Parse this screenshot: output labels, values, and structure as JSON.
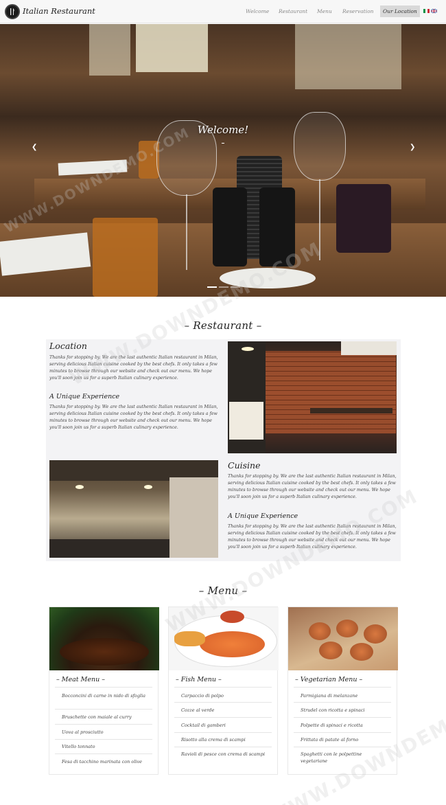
{
  "nav": {
    "brand": "Italian Restaurant",
    "links": [
      "Welcome",
      "Restaurant",
      "Menu",
      "Reservation",
      "Our Location"
    ],
    "active": "Our Location"
  },
  "hero": {
    "title": "Welcome!",
    "prev_icon": "chevron-left-icon",
    "next_icon": "chevron-right-icon",
    "slides": 3,
    "active_slide": 1
  },
  "restaurant": {
    "title": "– Restaurant –",
    "location": {
      "heading": "Location",
      "text": "Thanks for stopping by. We are the last authentic Italian restaurant in Milan, serving delicious Italian cuisine cooked by the best chefs. It only takes a few minutes to browse through our website and check out our menu. We hope you'll soon join us for a superb Italian culinary experience."
    },
    "unique1": {
      "heading": "A Unique Experience",
      "text": "Thanks for stopping by. We are the last authentic Italian restaurant in Milan, serving delicious Italian cuisine cooked by the best chefs. It only takes a few minutes to browse through our website and check out our menu. We hope you'll soon join us for a superb Italian culinary experience."
    },
    "cuisine": {
      "heading": "Cuisine",
      "text": "Thanks for stopping by. We are the last authentic Italian restaurant in Milan, serving delicious Italian cuisine cooked by the best chefs. It only takes a few minutes to browse through our website and check out our menu. We hope you'll soon join us for a superb Italian culinary experience."
    },
    "unique2": {
      "heading": "A Unique Experience",
      "text": "Thanks for stopping by. We are the last authentic Italian restaurant in Milan, serving delicious Italian cuisine cooked by the best chefs. It only takes a few minutes to browse through our website and check out our menu. We hope you'll soon join us for a superb Italian culinary experience."
    }
  },
  "menu": {
    "title": "– Menu –",
    "cards": [
      {
        "title": "– Meat Menu –",
        "items": [
          "Bocconcini di carne in nido di sfoglia",
          "Bruschette con maiale al curry",
          "Uova al prosciutto",
          "Vitello tonnato",
          "Fesa di tacchino marinata con olive"
        ]
      },
      {
        "title": "– Fish Menu –",
        "items": [
          "Carpaccio di polpo",
          "Cozze al verde",
          "Cocktail di gamberi",
          "Risotto alla crema di scampi",
          "Ravioli di pesce con crema di scampi"
        ]
      },
      {
        "title": "– Vegetarian Menu –",
        "items": [
          "Parmigiana di melanzane",
          "Strudel con ricotta e spinaci",
          "Polpette di spinaci e ricotta",
          "Frittata di patate al forno",
          "Spaghetti con le polpettine vegetariane"
        ]
      }
    ]
  },
  "watermark": "WWW.DOWNDEMO.COM",
  "colors": {
    "nav_bg": "#f7f7f7",
    "active_tab": "#d9d9d9",
    "section_bg": "#f3f3f5"
  }
}
